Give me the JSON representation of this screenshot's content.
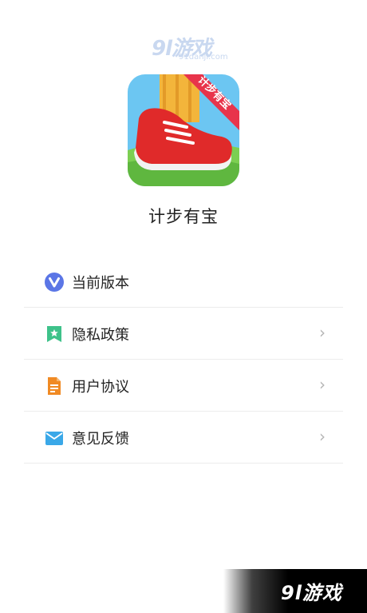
{
  "watermark": {
    "top_logo": "9l游戏",
    "top_url": "91danji.com",
    "bottom_logo": "9l游戏"
  },
  "app": {
    "icon": "running-shoe-app-icon",
    "icon_badge": "计步有宝",
    "name": "计步有宝"
  },
  "menu": {
    "items": [
      {
        "label": "当前版本",
        "icon": "v-badge-icon",
        "has_chevron": false
      },
      {
        "label": "隐私政策",
        "icon": "bookmark-star-icon",
        "has_chevron": true,
        "chevron": "›"
      },
      {
        "label": "用户协议",
        "icon": "document-icon",
        "has_chevron": true,
        "chevron": "›"
      },
      {
        "label": "意见反馈",
        "icon": "mail-icon",
        "has_chevron": true,
        "chevron": "›"
      }
    ]
  },
  "colors": {
    "version_icon": "#5b76e6",
    "privacy_icon": "#3ec28a",
    "agreement_icon": "#f08a24",
    "feedback_icon": "#3aa8e8"
  }
}
